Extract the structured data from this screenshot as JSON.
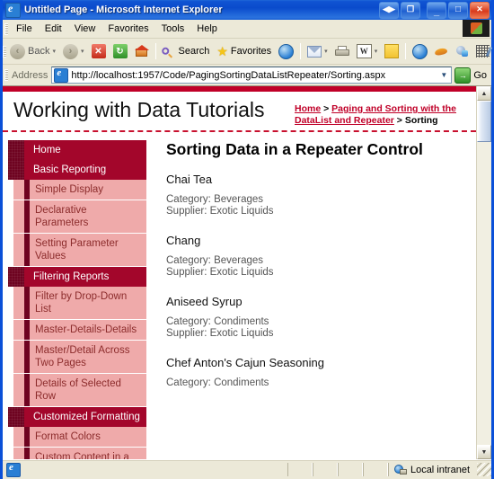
{
  "window": {
    "title": "Untitled Page - Microsoft Internet Explorer",
    "app_icon": "ie-logo-icon",
    "buttons": {
      "restore_group": "◀▶",
      "restore_window": "❐",
      "minimize": "_",
      "maximize": "□",
      "close": "✕"
    }
  },
  "menu": {
    "items": [
      {
        "label": "File"
      },
      {
        "label": "Edit"
      },
      {
        "label": "View"
      },
      {
        "label": "Favorites"
      },
      {
        "label": "Tools"
      },
      {
        "label": "Help"
      }
    ]
  },
  "toolbar": {
    "back_label": "Back",
    "forward_label": "",
    "stop_label": "✕",
    "refresh_label": "↻",
    "home_label": "",
    "search_label": "Search",
    "favorites_label": "Favorites",
    "history_label": "",
    "mail_label": "",
    "print_label": "",
    "edit_word_label": "W",
    "notes_label": "",
    "msn_globe_label": "",
    "messenger_label": "",
    "discuss_label": "",
    "caret": "▾"
  },
  "address": {
    "label": "Address",
    "url": "http://localhost:1957/Code/PagingSortingDataListRepeater/Sorting.aspx",
    "dropdown_caret": "▼",
    "go_label": "Go",
    "go_arrow": "→"
  },
  "page": {
    "site_title": "Working with Data Tutorials",
    "breadcrumb": {
      "home": "Home",
      "sep1": " > ",
      "section": "Paging and Sorting with the DataList and Repeater",
      "sep2": " > ",
      "current": "Sorting"
    },
    "heading": "Sorting Data in a Repeater Control",
    "sidebar": {
      "groups": [
        {
          "header": "Home",
          "is_header_only": true,
          "items": []
        },
        {
          "header": "Basic Reporting",
          "items": [
            {
              "label": "Simple Display"
            },
            {
              "label": "Declarative Parameters"
            },
            {
              "label": "Setting Parameter Values"
            }
          ]
        },
        {
          "header": "Filtering Reports",
          "items": [
            {
              "label": "Filter by Drop-Down List"
            },
            {
              "label": "Master-Details-Details"
            },
            {
              "label": "Master/Detail Across Two Pages"
            },
            {
              "label": "Details of Selected Row"
            }
          ]
        },
        {
          "header": "Customized Formatting",
          "items": [
            {
              "label": "Format Colors"
            },
            {
              "label": "Custom Content in a"
            }
          ]
        }
      ]
    },
    "products": [
      {
        "name": "Chai Tea",
        "category_label": "Category:",
        "category": "Beverages",
        "supplier_label": "Supplier:",
        "supplier": "Exotic Liquids"
      },
      {
        "name": "Chang",
        "category_label": "Category:",
        "category": "Beverages",
        "supplier_label": "Supplier:",
        "supplier": "Exotic Liquids"
      },
      {
        "name": "Aniseed Syrup",
        "category_label": "Category:",
        "category": "Condiments",
        "supplier_label": "Supplier:",
        "supplier": "Exotic Liquids"
      },
      {
        "name": "Chef Anton's Cajun Seasoning",
        "category_label": "Category:",
        "category": "Condiments",
        "supplier_label": "Supplier:",
        "supplier": ""
      }
    ]
  },
  "scrollbar": {
    "up_arrow": "▲",
    "down_arrow": "▼"
  },
  "statusbar": {
    "message": "",
    "zone": "Local intranet"
  },
  "colors": {
    "brand_red": "#C00028",
    "nav_header": "#A3062B",
    "nav_header_accent": "#6E0320",
    "nav_item_bg": "#EFAAAA",
    "nav_item_text": "#8C2C2C",
    "link_red": "#C00028",
    "titlebar_blue": "#0A4BCC",
    "chrome": "#ECE9D8"
  }
}
